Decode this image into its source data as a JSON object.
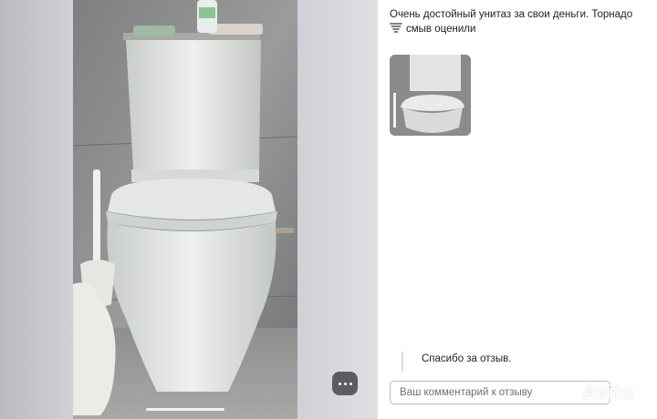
{
  "review": {
    "text_line1": "Очень достойный унитаз за свои деньги. Торнадо",
    "emoji_icon": "tornado-icon",
    "text_line2": "смыв оценили"
  },
  "reply": {
    "text": "Спасибо за отзыв."
  },
  "comment_input": {
    "placeholder": "Ваш комментарий к отзыву",
    "value": ""
  },
  "watermark": {
    "text": "Avito"
  },
  "icons": {
    "more": "more-dots-icon"
  },
  "colors": {
    "more_button_bg": "#5b5d63",
    "input_border": "#b9bcc2"
  }
}
